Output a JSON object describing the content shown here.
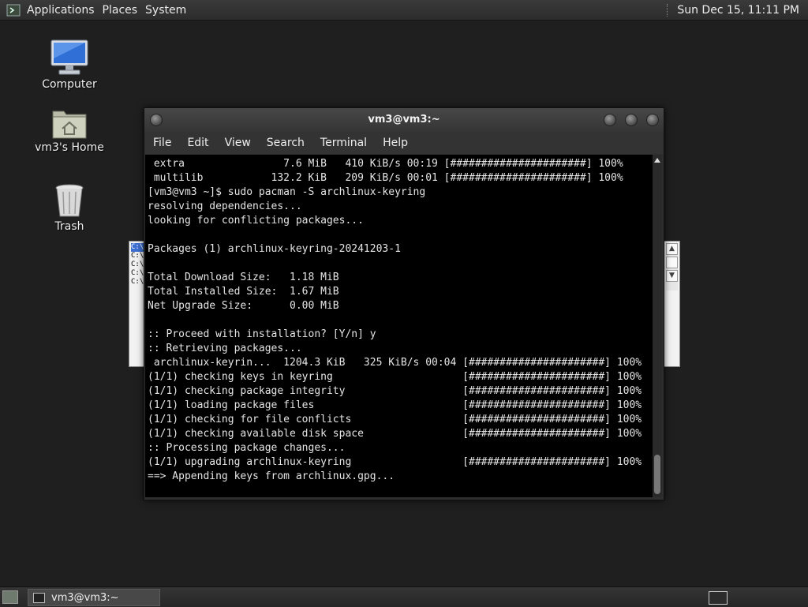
{
  "top_panel": {
    "menus": [
      "Applications",
      "Places",
      "System"
    ],
    "clock": "Sun Dec 15, 11:11 PM"
  },
  "desktop": {
    "icons": [
      {
        "label": "Computer",
        "icon": "computer-icon"
      },
      {
        "label": "vm3's Home",
        "icon": "home-folder-icon"
      },
      {
        "label": "Trash",
        "icon": "trash-icon"
      }
    ]
  },
  "background_window": {
    "lines": [
      "C:\\\\",
      "C:\\\\",
      "C:\\\\",
      "C:\\\\",
      "C:\\\\"
    ]
  },
  "terminal": {
    "title": "vm3@vm3:~",
    "menus": [
      "File",
      "Edit",
      "View",
      "Search",
      "Terminal",
      "Help"
    ],
    "output": " extra                7.6 MiB   410 KiB/s 00:19 [######################] 100%\n multilib           132.2 KiB   209 KiB/s 00:01 [######################] 100%\n[vm3@vm3 ~]$ sudo pacman -S archlinux-keyring\nresolving dependencies...\nlooking for conflicting packages...\n\nPackages (1) archlinux-keyring-20241203-1\n\nTotal Download Size:   1.18 MiB\nTotal Installed Size:  1.67 MiB\nNet Upgrade Size:      0.00 MiB\n\n:: Proceed with installation? [Y/n] y\n:: Retrieving packages...\n archlinux-keyrin...  1204.3 KiB   325 KiB/s 00:04 [######################] 100%\n(1/1) checking keys in keyring                     [######################] 100%\n(1/1) checking package integrity                   [######################] 100%\n(1/1) loading package files                        [######################] 100%\n(1/1) checking for file conflicts                  [######################] 100%\n(1/1) checking available disk space                [######################] 100%\n:: Processing package changes...\n(1/1) upgrading archlinux-keyring                  [######################] 100%\n==> Appending keys from archlinux.gpg..."
  },
  "taskbar": {
    "task_label": "vm3@vm3:~"
  }
}
